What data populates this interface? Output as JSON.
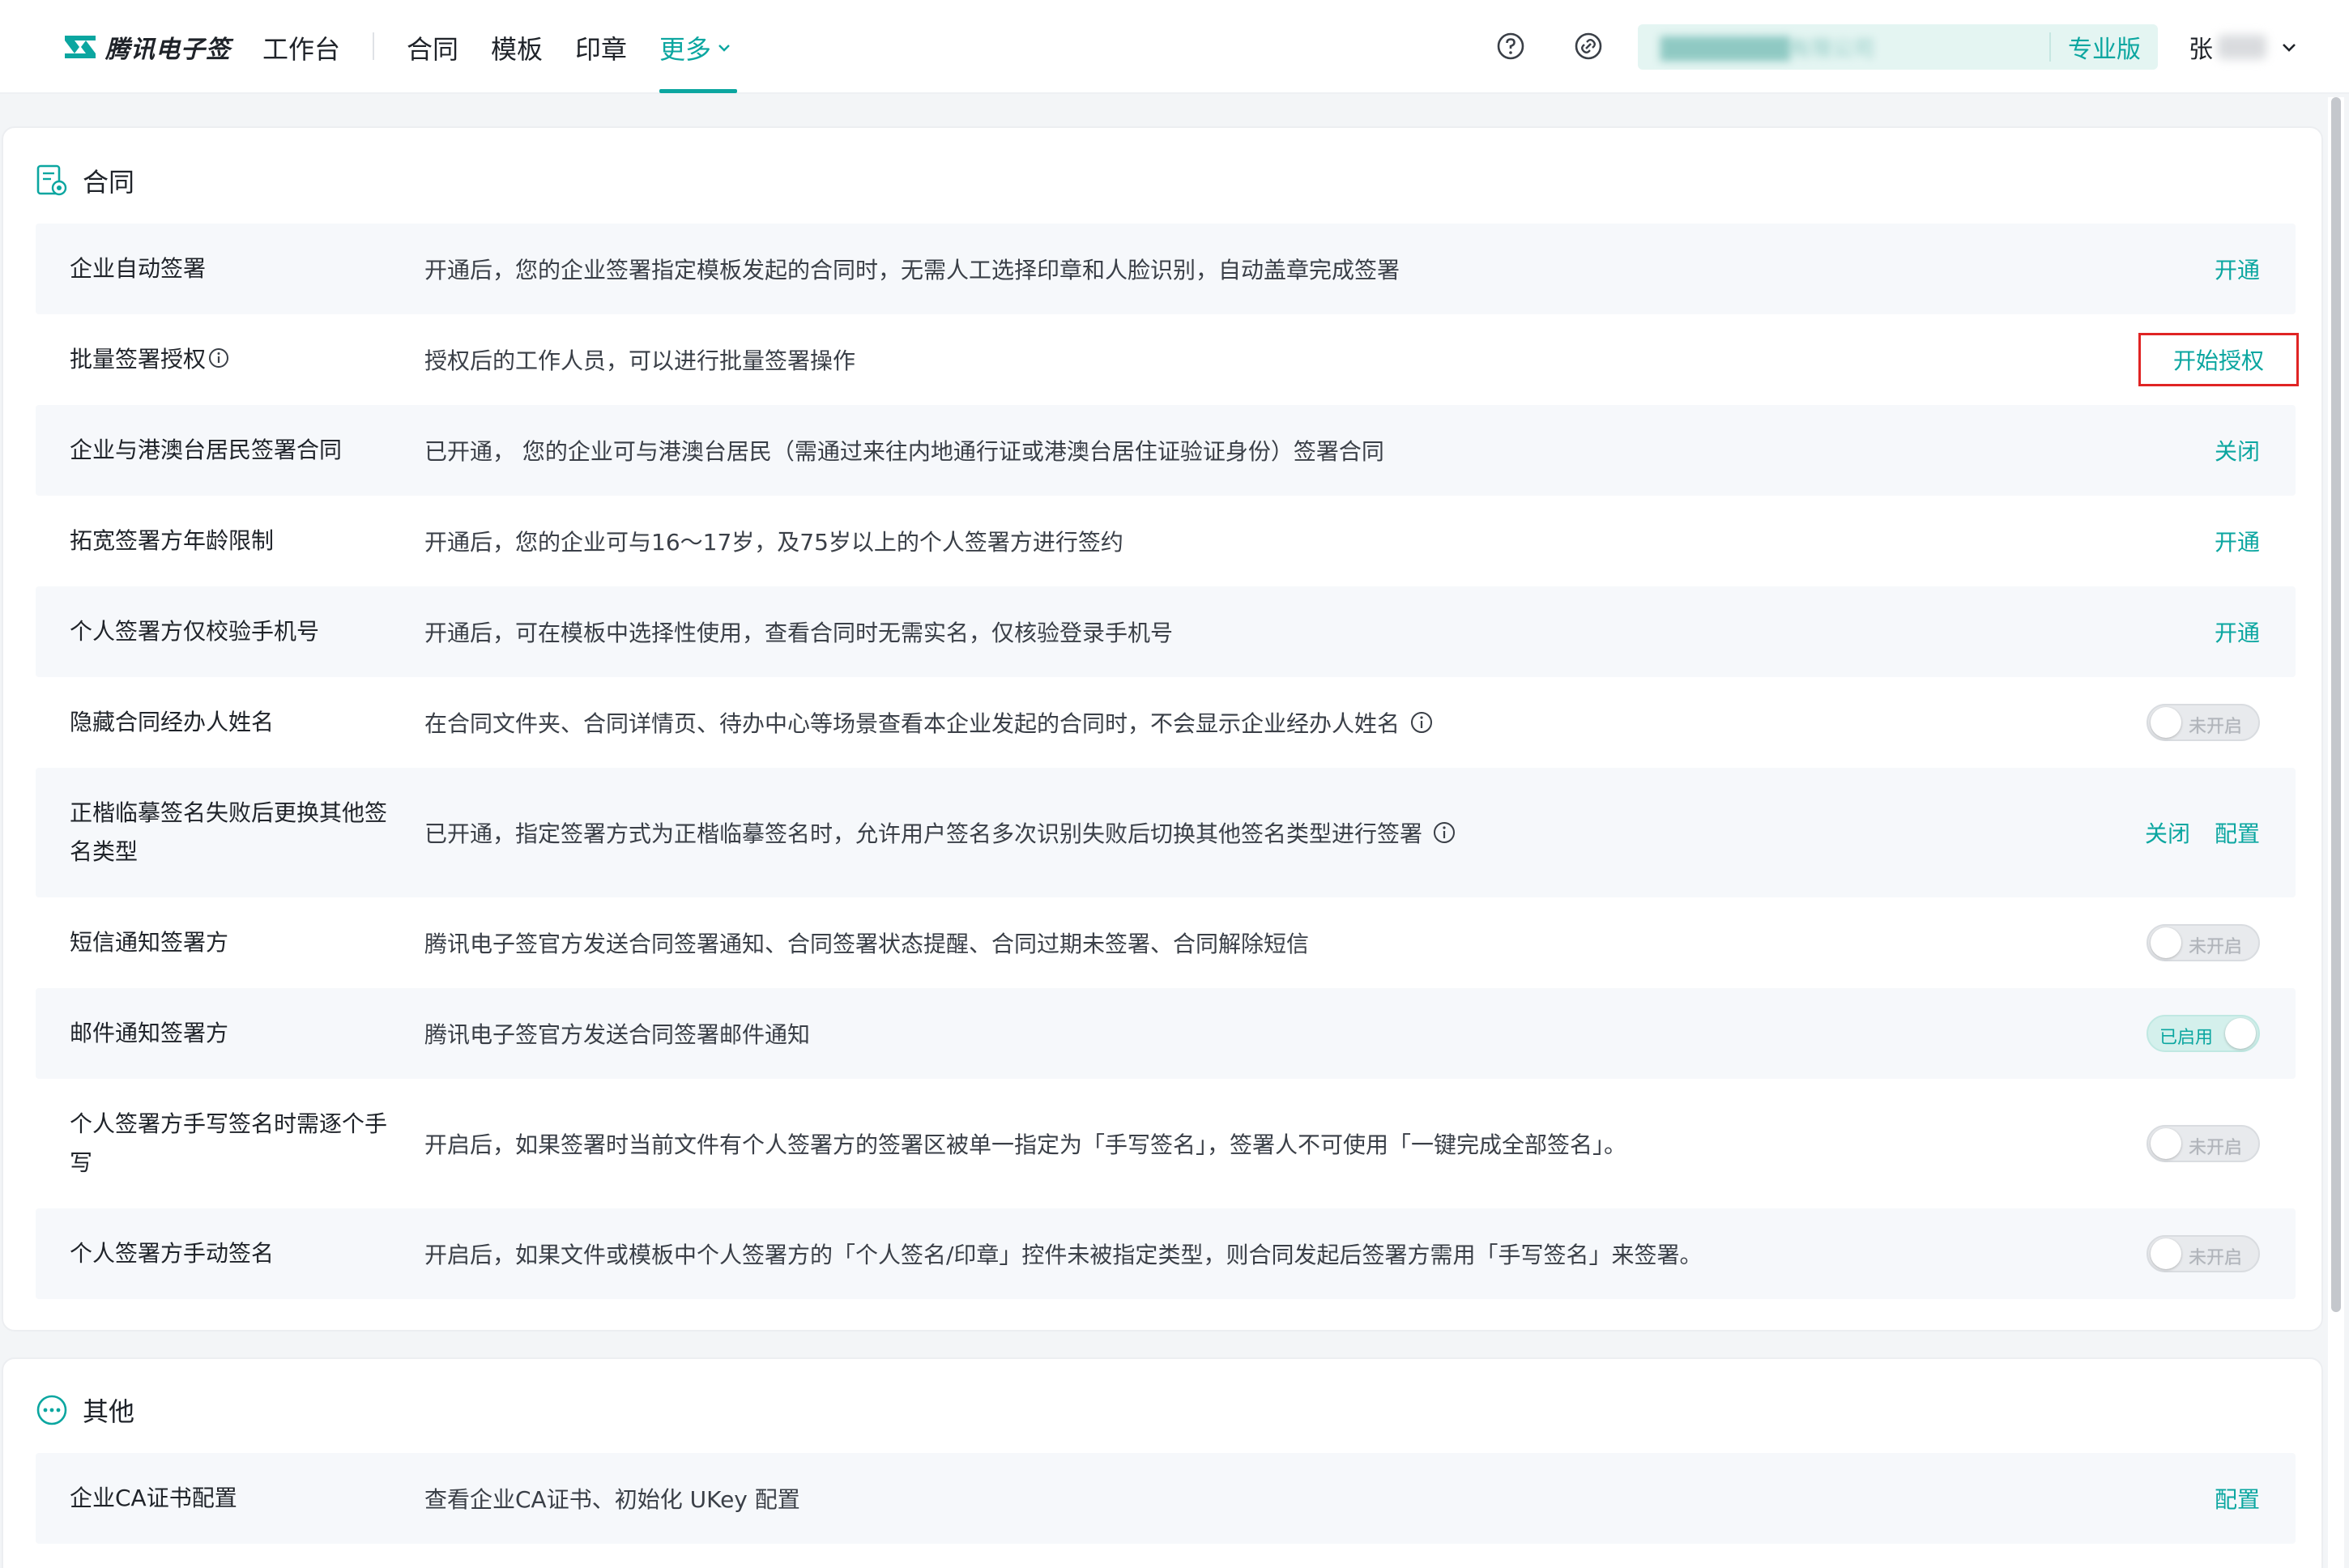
{
  "header": {
    "logo_text": "腾讯电子签",
    "nav": [
      {
        "label": "工作台"
      },
      {
        "label": "合同"
      },
      {
        "label": "模板"
      },
      {
        "label": "印章"
      },
      {
        "label": "更多"
      }
    ],
    "org_name": "████████有限公司",
    "edition": "专业版",
    "user_name": "张",
    "accent_color": "#0ba6a0"
  },
  "contract_section": {
    "title": "合同",
    "rows": [
      {
        "title": "企业自动签署",
        "desc": "开通后，您的企业签署指定模板发起的合同时，无需人工选择印章和人脸识别，自动盖章完成签署",
        "action": "开通"
      },
      {
        "title": "批量签署授权",
        "desc": "授权后的工作人员，可以进行批量签署操作",
        "action": "开始授权"
      },
      {
        "title": "企业与港澳台居民签署合同",
        "desc": "已开通， 您的企业可与港澳台居民（需通过来往内地通行证或港澳台居住证验证身份）签署合同",
        "action": "关闭"
      },
      {
        "title": "拓宽签署方年龄限制",
        "desc": "开通后，您的企业可与16～17岁，及75岁以上的个人签署方进行签约",
        "action": "开通"
      },
      {
        "title": "个人签署方仅校验手机号",
        "desc": "开通后，可在模板中选择性使用，查看合同时无需实名，仅核验登录手机号",
        "action": "开通"
      },
      {
        "title": "隐藏合同经办人姓名",
        "desc": "在合同文件夹、合同详情页、待办中心等场景查看本企业发起的合同时，不会显示企业经办人姓名",
        "toggle": "未开启"
      },
      {
        "title": "正楷临摹签名失败后更换其他签名类型",
        "desc": "已开通，指定签署方式为正楷临摹签名时，允许用户签名多次识别失败后切换其他签名类型进行签署",
        "action_a": "关闭",
        "action_b": "配置"
      },
      {
        "title": "短信通知签署方",
        "desc": "腾讯电子签官方发送合同签署通知、合同签署状态提醒、合同过期未签署、合同解除短信",
        "toggle": "未开启"
      },
      {
        "title": "邮件通知签署方",
        "desc": "腾讯电子签官方发送合同签署邮件通知",
        "toggle": "已启用"
      },
      {
        "title": "个人签署方手写签名时需逐个手写",
        "desc": "开启后，如果签署时当前文件有个人签署方的签署区被单一指定为「手写签名」，签署人不可使用「一键完成全部签名」。",
        "toggle": "未开启"
      },
      {
        "title": "个人签署方手动签名",
        "desc": "开启后，如果文件或模板中个人签署方的「个人签名/印章」控件未被指定类型，则合同发起后签署方需用「手写签名」来签署。",
        "toggle": "未开启"
      }
    ]
  },
  "other_section": {
    "title": "其他",
    "rows": [
      {
        "title": "企业CA证书配置",
        "desc": "查看企业CA证书、初始化 UKey 配置",
        "action": "配置"
      }
    ]
  }
}
